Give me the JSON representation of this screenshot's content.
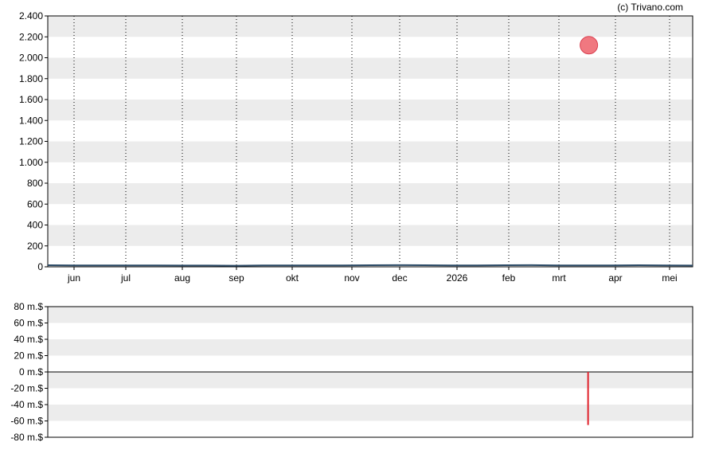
{
  "credit": "(c) Trivano.com",
  "chart_data": [
    {
      "type": "line",
      "title": "",
      "x_labels": [
        "jun",
        "jul",
        "aug",
        "sep",
        "okt",
        "nov",
        "dec",
        "2026",
        "feb",
        "mrt",
        "apr",
        "mei"
      ],
      "y_tick_labels": [
        "0",
        "200",
        "400",
        "600",
        "800",
        "1.000",
        "1.200",
        "1.400",
        "1.600",
        "1.800",
        "2.000",
        "2.200",
        "2.400"
      ],
      "ylim": [
        0,
        2400
      ],
      "grid": "horizontal bands + dotted vertical month lines",
      "series": [
        {
          "values": [
            15,
            14,
            14,
            13,
            13,
            12,
            12,
            11,
            13,
            14,
            13,
            14,
            15,
            16,
            15,
            14,
            14,
            15,
            16,
            14,
            13,
            14,
            15,
            13,
            12
          ]
        }
      ],
      "markers": [
        {
          "x": "mrt-apr",
          "y": 2120,
          "color": "#ef6b7a"
        }
      ],
      "colors": {
        "line": "#2b4a66",
        "band": "#ececec",
        "marker": "#f07880",
        "marker_stroke": "#d94050"
      }
    },
    {
      "type": "bar",
      "title": "",
      "y_tick_labels": [
        "80 m.$",
        "60 m.$",
        "40 m.$",
        "20 m.$",
        "0 m.$",
        "-20 m.$",
        "-40 m.$",
        "-60 m.$",
        "-80 m.$"
      ],
      "ylim": [
        -80,
        80
      ],
      "bars": [
        {
          "x": "mrt-apr",
          "value": -65,
          "color": "#e0202a"
        }
      ]
    }
  ]
}
